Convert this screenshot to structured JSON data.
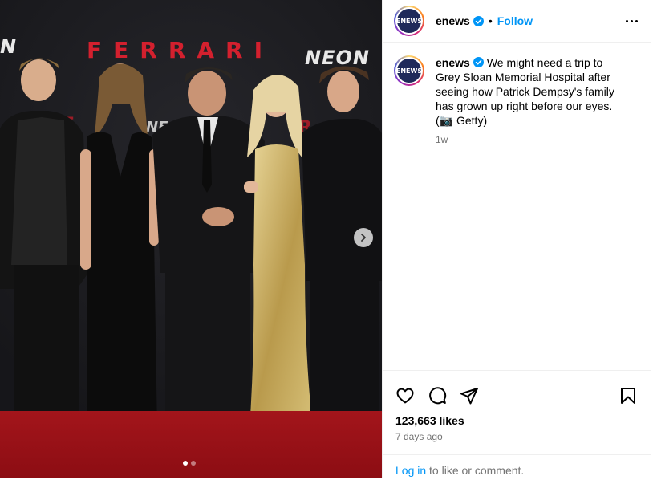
{
  "header": {
    "username": "enews",
    "separator": "•",
    "follow_label": "Follow",
    "avatar_text": "ENEWS"
  },
  "caption": {
    "username": "enews",
    "text": "We might need a trip to Grey Sloan Memorial Hospital after seeing how Patrick Dempsy's family has grown up right before our eyes. (📷 Getty)",
    "time": "1w"
  },
  "media": {
    "sign_ferrari": "FERRARI",
    "sign_neon": "NEON",
    "sign_neon_left": "N",
    "carousel_index": 1,
    "carousel_count": 2
  },
  "footer": {
    "likes": "123,663 likes",
    "time_ago": "7 days ago",
    "login_link": "Log in",
    "login_rest": " to like or comment."
  },
  "colors": {
    "link_blue": "#0095f6",
    "muted_text": "#737373",
    "border": "#dbdbdb"
  },
  "icons": {
    "like": "heart-icon",
    "comment": "comment-icon",
    "share": "send-icon",
    "save": "bookmark-icon",
    "more": "more-options-icon",
    "verified": "verified-badge-icon",
    "carousel_next": "chevron-right-icon"
  }
}
